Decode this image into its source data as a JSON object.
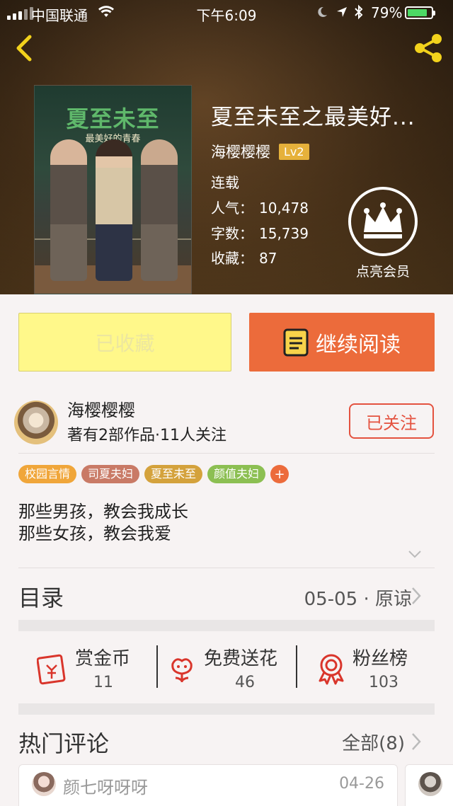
{
  "status_bar": {
    "carrier": "中国联通",
    "time": "下午6:09",
    "battery_pct": "79%",
    "battery_level": 0.79
  },
  "header": {
    "back_icon": "chevron-left-icon",
    "share_icon": "share-icon"
  },
  "book": {
    "cover_title": "夏至未至",
    "cover_subtitle": "最美好的青春",
    "title": "夏至未至之最美好...",
    "author": "海樱樱樱",
    "level": "Lv2",
    "status": "连载",
    "stats": [
      {
        "label": "人气：",
        "value": "10,478"
      },
      {
        "label": "字数：",
        "value": "15,739"
      },
      {
        "label": "收藏：",
        "value": "87"
      }
    ],
    "vip_label": "点亮会员"
  },
  "buttons": {
    "favorited": "已收藏",
    "continue_reading": "继续阅读"
  },
  "author_card": {
    "name": "海樱樱樱",
    "meta": "著有2部作品·11人关注",
    "follow": "已关注"
  },
  "tags": [
    {
      "label": "校园言情",
      "color": "#f0a63a"
    },
    {
      "label": "司夏夫妇",
      "color": "#c97a66"
    },
    {
      "label": "夏至未至",
      "color": "#d4a23c"
    },
    {
      "label": "颜值夫妇",
      "color": "#8cbf52"
    }
  ],
  "tag_add": "+",
  "description": {
    "line1": "那些男孩，教会我成长",
    "line2": "那些女孩，教会我爱"
  },
  "toc": {
    "title": "目录",
    "latest": "05-05 · 原谅"
  },
  "actions": [
    {
      "label": "赏金币",
      "value": "11",
      "icon": "red-envelope-icon"
    },
    {
      "label": "免费送花",
      "value": "46",
      "icon": "flower-icon"
    },
    {
      "label": "粉丝榜",
      "value": "103",
      "icon": "medal-icon"
    }
  ],
  "comments": {
    "title": "热门评论",
    "all": "全部(8)",
    "items": [
      {
        "user": "颜七呀呀呀",
        "date": "04-26"
      }
    ]
  },
  "colors": {
    "accent": "#ec6b3b",
    "follow": "#e4523f",
    "favorited_bg": "#fff88a",
    "level_badge": "#e6b13b",
    "header_icons": "#f2d21c"
  }
}
